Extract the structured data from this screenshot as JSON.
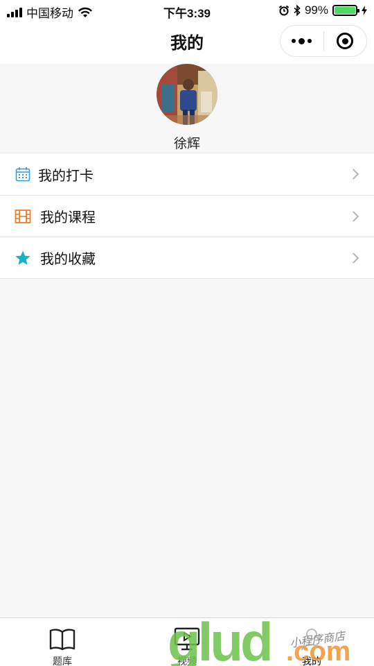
{
  "status_bar": {
    "carrier": "中国移动",
    "time": "下午3:39",
    "battery": "99%",
    "battery_level": 0.99
  },
  "nav": {
    "title": "我的"
  },
  "profile": {
    "username": "徐辉"
  },
  "menu": {
    "items": [
      {
        "label": "我的打卡",
        "icon": "calendar-icon",
        "color": "#2d9cdb"
      },
      {
        "label": "我的课程",
        "icon": "film-icon",
        "color": "#f07c27"
      },
      {
        "label": "我的收藏",
        "icon": "star-icon",
        "color": "#1ab2c6"
      }
    ]
  },
  "tabs": [
    {
      "label": "题库",
      "icon": "book-icon"
    },
    {
      "label": "视频",
      "icon": "monitor-icon"
    },
    {
      "label": "我的",
      "icon": "user-icon",
      "active": true
    }
  ],
  "watermark": {
    "text": "小程序商店",
    "logo": "glud.com"
  }
}
